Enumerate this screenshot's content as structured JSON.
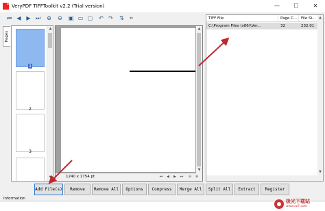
{
  "window": {
    "title": "VeryPDF TIFFToolkit v2.2 (Trial version)",
    "minimize_glyph": "—",
    "maximize_glyph": "☐",
    "close_glyph": "✕"
  },
  "toolbar": {
    "icons": [
      "first-page-icon",
      "previous-page-icon",
      "next-page-icon",
      "last-page-icon",
      "zoom-in-icon",
      "zoom-out-icon",
      "fit-page-icon",
      "fit-width-icon",
      "actual-size-icon",
      "rotate-left-icon",
      "rotate-right-icon",
      "flip-icon",
      "crop-icon"
    ]
  },
  "sidebar": {
    "tab_label": "Pages",
    "thumbnails": [
      {
        "number": "1",
        "selected": true
      },
      {
        "number": "2",
        "selected": false
      },
      {
        "number": "3",
        "selected": false
      }
    ]
  },
  "viewer": {
    "dimensions": "1240 x 1754 pt"
  },
  "file_list": {
    "columns": [
      "TIFF File",
      "Page C...",
      "File Si..."
    ],
    "rows": [
      {
        "file": "C:\\Program Files (x86)\\Ver...",
        "pages": "32",
        "size": "232.01"
      }
    ]
  },
  "buttons": {
    "add_files": "Add File(s)",
    "remove": "Remove",
    "remove_all": "Remove All",
    "options": "Options",
    "compress": "Compress",
    "merge_all": "Merge All",
    "split_all": "Split All",
    "extract": "Extract",
    "register": "Register"
  },
  "info": {
    "label": "Information"
  },
  "watermark": {
    "text": "极光下载站",
    "url": "www.xz7.com"
  },
  "colors": {
    "arrow": "#c0282d",
    "selection": "#8db8f0",
    "focus_border": "#2f7bd5"
  }
}
